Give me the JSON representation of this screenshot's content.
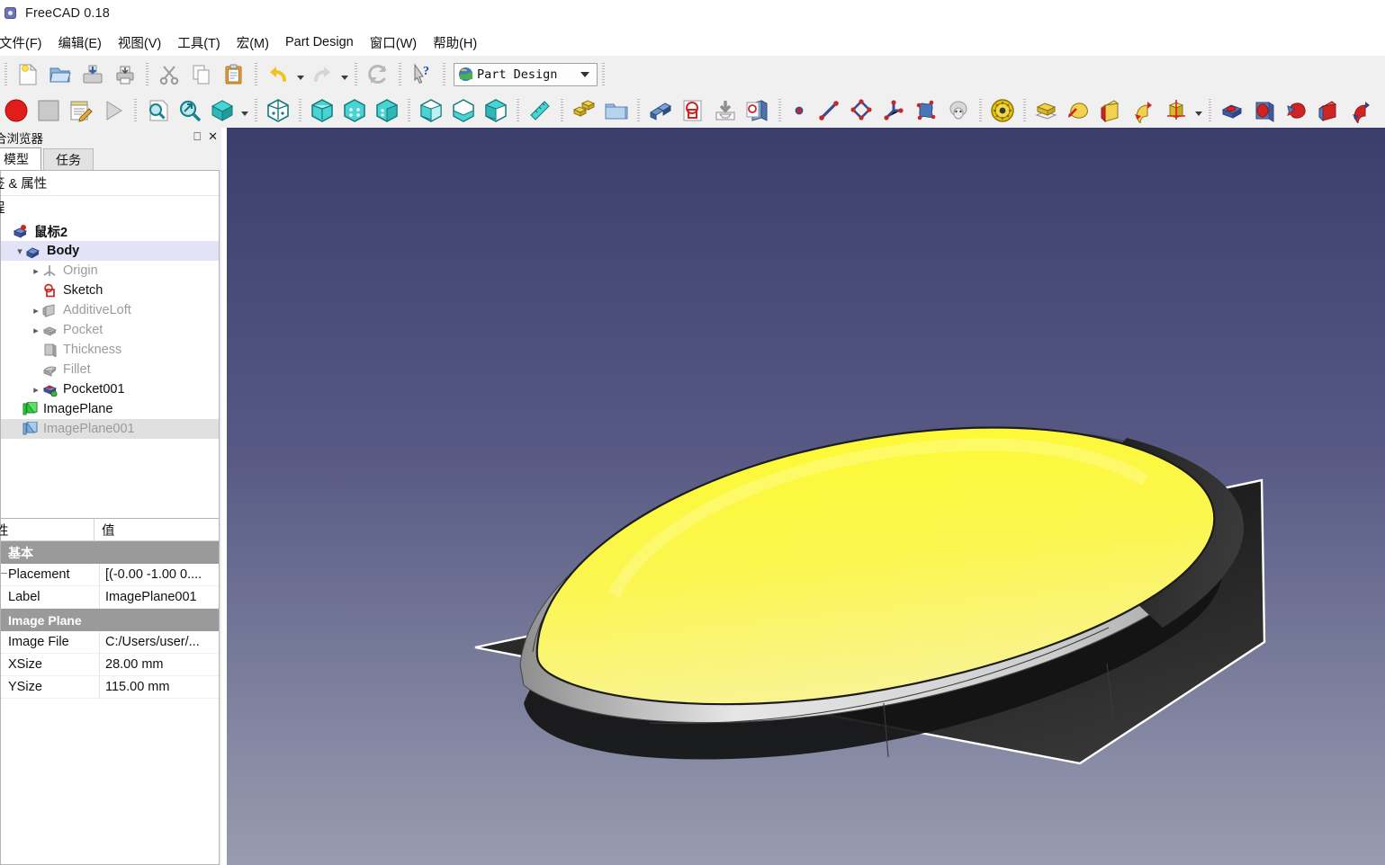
{
  "window": {
    "title": "FreeCAD 0.18",
    "icon": "freecad-logo-icon"
  },
  "menubar": {
    "items": [
      {
        "label": "文件(F)",
        "name": "menu-file"
      },
      {
        "label": "编辑(E)",
        "name": "menu-edit"
      },
      {
        "label": "视图(V)",
        "name": "menu-view"
      },
      {
        "label": "工具(T)",
        "name": "menu-tools"
      },
      {
        "label": "宏(M)",
        "name": "menu-macro"
      },
      {
        "label": "Part Design",
        "name": "menu-part-design"
      },
      {
        "label": "窗口(W)",
        "name": "menu-window"
      },
      {
        "label": "帮助(H)",
        "name": "menu-help"
      }
    ]
  },
  "toolbars": {
    "file_row": [
      "new-document-icon",
      "open-document-icon",
      "save-document-icon",
      "print-document-icon",
      "cut-icon",
      "copy-icon",
      "paste-icon",
      "undo-icon",
      "redo-icon",
      "refresh-icon",
      "whats-this-icon"
    ],
    "workbench": {
      "selected": "Part Design",
      "icon": "part-design-workbench-icon"
    },
    "macro_row": [
      "macro-stop-icon",
      "macro-record-icon",
      "macro-edit-icon",
      "macro-execute-icon",
      "fit-all-icon",
      "zoom-box-icon",
      "axonometric-view-icon",
      "isometric-view-icon",
      "front-view-icon",
      "top-view-icon",
      "right-view-icon",
      "rear-view-icon",
      "bottom-view-icon",
      "left-view-icon",
      "measure-icon",
      "create-part-icon",
      "create-group-icon",
      "create-body-icon",
      "create-sketch-icon",
      "edit-sketch-icon",
      "validate-sketch-icon",
      "sketch-point-icon",
      "sketch-line-icon",
      "sketch-polyline-icon",
      "sketch-constraint-icon",
      "sketch-bspline-icon",
      "sketch-sheep-icon",
      "sketch-gear-icon",
      "pad-icon",
      "revolution-icon",
      "additive-loft-icon",
      "additive-pipe-icon",
      "additive-primitive-icon",
      "pocket-icon",
      "hole-icon",
      "groove-icon",
      "subtractive-loft-icon",
      "subtractive-pipe-icon"
    ]
  },
  "dock": {
    "title": "合浏览器",
    "float_button": "restore-icon",
    "close_button": "close-icon",
    "tabs": [
      {
        "label": "模型",
        "name": "tab-model",
        "active": true
      },
      {
        "label": "任务",
        "name": "tab-tasks",
        "active": false
      }
    ]
  },
  "tree": {
    "header": {
      "col1": "签 & 属性",
      "col2": ""
    },
    "subheader": "程",
    "items": [
      {
        "label": "鼠标2",
        "icon": "document-icon",
        "indent": 0,
        "twisty": "",
        "state": "bold",
        "selected": ""
      },
      {
        "label": "Body",
        "icon": "body-icon",
        "indent": 1,
        "twisty": "v",
        "state": "bold",
        "selected": "blue"
      },
      {
        "label": "Origin",
        "icon": "origin-icon",
        "indent": 2,
        "twisty": ">",
        "state": "dim",
        "selected": ""
      },
      {
        "label": "Sketch",
        "icon": "sketch-icon",
        "indent": 2,
        "twisty": "",
        "state": "",
        "selected": ""
      },
      {
        "label": "AdditiveLoft",
        "icon": "additive-loft-icon",
        "indent": 2,
        "twisty": ">",
        "state": "dim",
        "selected": ""
      },
      {
        "label": "Pocket",
        "icon": "pocket-icon",
        "indent": 2,
        "twisty": ">",
        "state": "dim",
        "selected": ""
      },
      {
        "label": "Thickness",
        "icon": "thickness-icon",
        "indent": 2,
        "twisty": "",
        "state": "dim",
        "selected": ""
      },
      {
        "label": "Fillet",
        "icon": "fillet-icon",
        "indent": 2,
        "twisty": "",
        "state": "dim",
        "selected": ""
      },
      {
        "label": "Pocket001",
        "icon": "pocket-tip-icon",
        "indent": 2,
        "twisty": ">",
        "state": "",
        "selected": ""
      },
      {
        "label": "ImagePlane",
        "icon": "image-plane-green-icon",
        "indent": 1,
        "twisty": "",
        "state": "",
        "selected": ""
      },
      {
        "label": "ImagePlane001",
        "icon": "image-plane-blue-icon",
        "indent": 1,
        "twisty": "",
        "state": "dim",
        "selected": "gray"
      }
    ]
  },
  "properties": {
    "header": {
      "col1": "性",
      "col2": "值"
    },
    "groups": [
      {
        "name": "基本",
        "rows": [
          {
            "key": "Placement",
            "value": "[(-0.00 -1.00 0....",
            "expandable": true
          },
          {
            "key": "Label",
            "value": "ImagePlane001",
            "expandable": false
          }
        ]
      },
      {
        "name": "Image Plane",
        "rows": [
          {
            "key": "Image File",
            "value": "C:/Users/user/...",
            "expandable": false
          },
          {
            "key": "XSize",
            "value": "28.00 mm",
            "expandable": false
          },
          {
            "key": "YSize",
            "value": "115.00 mm",
            "expandable": false
          }
        ]
      }
    ]
  },
  "viewport": {
    "name": "3d-view",
    "background_top": "#3b3d6b",
    "background_bottom": "#989cb0",
    "model": {
      "top_face_color": "#fbf94d",
      "side_face_color": "#d7d7d7",
      "image_plane_color": "#2a2a2a",
      "image_plane_border": "#ffffff",
      "description": "rounded shell body with highlighted yellow top face over a dark image plane"
    }
  }
}
